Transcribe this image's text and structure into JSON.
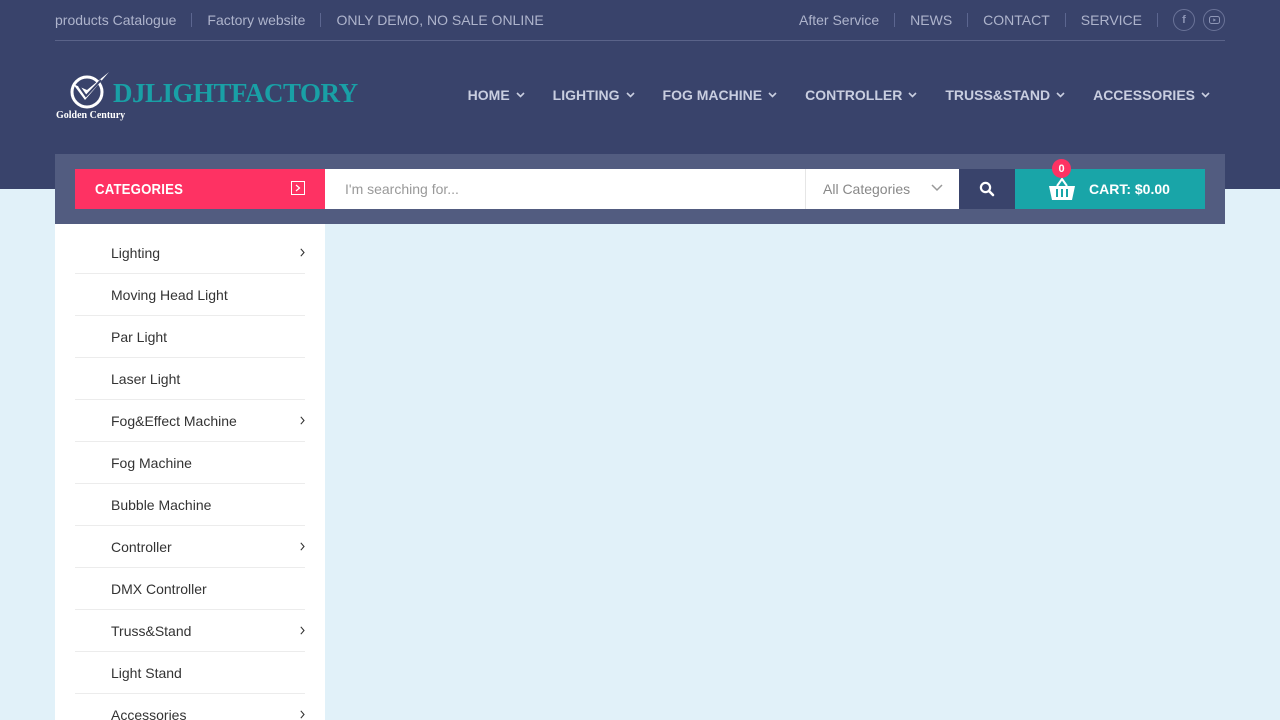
{
  "topbar": {
    "left_links": [
      "products Catalogue",
      "Factory website",
      "ONLY DEMO, NO SALE ONLINE"
    ],
    "right_links": [
      "After Service",
      "NEWS",
      "CONTACT",
      "SERVICE"
    ],
    "social": {
      "facebook": "f",
      "youtube": "▶"
    }
  },
  "logo": {
    "name": "DJLIGHTFACTORY",
    "tagline": "Golden Century"
  },
  "nav": [
    "HOME",
    "LIGHTING",
    "FOG MACHINE",
    "CONTROLLER",
    "TRUSS&STAND",
    "ACCESSORIES"
  ],
  "search": {
    "categories_label": "CATEGORIES",
    "placeholder": "I'm searching for...",
    "category_select": "All Categories"
  },
  "cart": {
    "count": "0",
    "label": "CART: $0.00"
  },
  "colors": {
    "header": "#39436b",
    "accent": "#fe3263",
    "teal": "#19a5a8",
    "page_bg": "#e1f1f9"
  },
  "sidebar": {
    "items": [
      {
        "label": "Lighting",
        "has_sub": true
      },
      {
        "label": "Moving Head Light",
        "has_sub": false
      },
      {
        "label": "Par Light",
        "has_sub": false
      },
      {
        "label": "Laser Light",
        "has_sub": false
      },
      {
        "label": "Fog&Effect Machine",
        "has_sub": true
      },
      {
        "label": "Fog Machine",
        "has_sub": false
      },
      {
        "label": "Bubble Machine",
        "has_sub": false
      },
      {
        "label": "Controller",
        "has_sub": true
      },
      {
        "label": "DMX Controller",
        "has_sub": false
      },
      {
        "label": "Truss&Stand",
        "has_sub": true
      },
      {
        "label": "Light Stand",
        "has_sub": false
      },
      {
        "label": "Accessories",
        "has_sub": true
      }
    ]
  }
}
